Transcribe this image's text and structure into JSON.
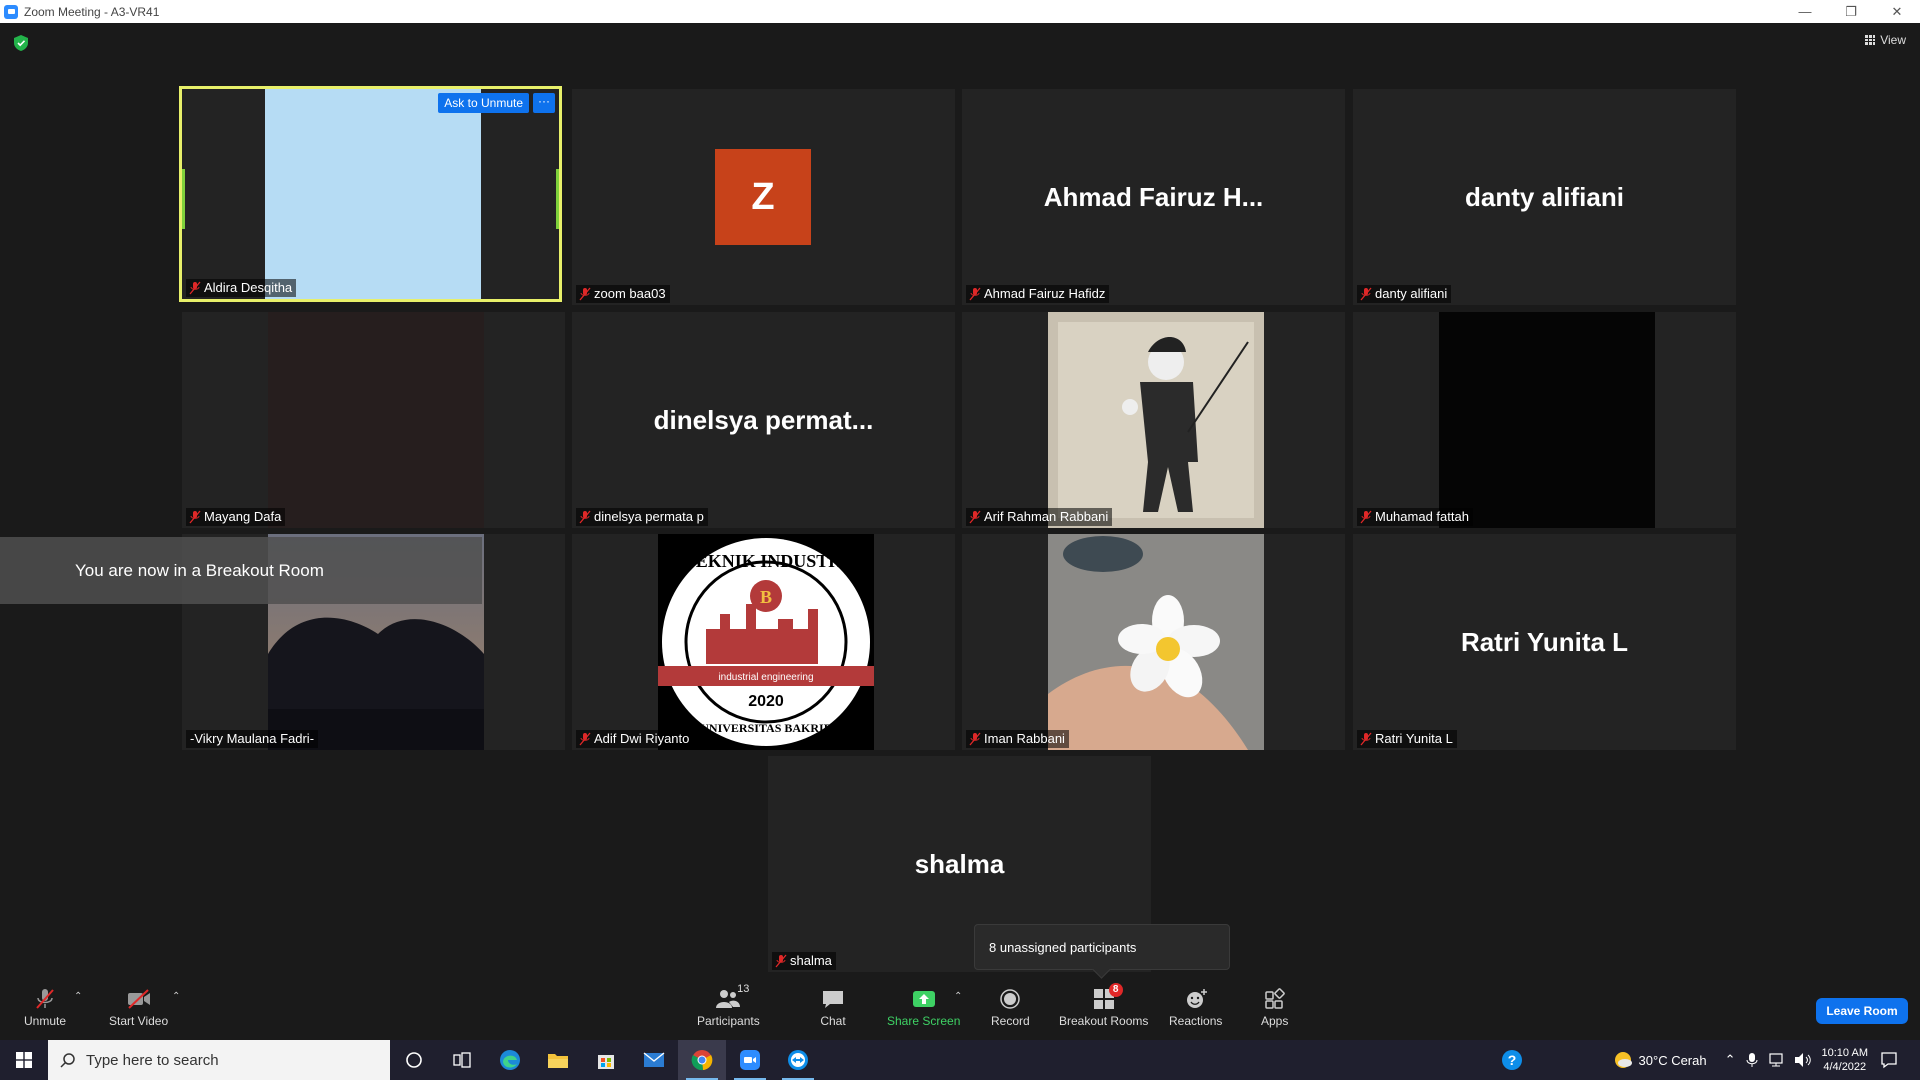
{
  "window": {
    "title": "Zoom Meeting - A3-VR41"
  },
  "header": {
    "view_label": "View"
  },
  "tiles": [
    {
      "name": "Aldira Desqitha",
      "ask_unmute": "Ask to Unmute",
      "more": "···"
    },
    {
      "name": "zoom baa03",
      "avatar_letter": "Z",
      "avatar_color": "#c7421a"
    },
    {
      "name": "Ahmad Fairuz Hafidz",
      "display_name": "Ahmad  Fairuz  H..."
    },
    {
      "name": "danty alifiani",
      "display_name": "danty alifiani"
    },
    {
      "name": "Mayang Dafa"
    },
    {
      "name": "dinelsya permata p",
      "display_name": "dinelsya  permat..."
    },
    {
      "name": "Arif Rahman Rabbani"
    },
    {
      "name": "Muhamad fattah"
    },
    {
      "name": "-Vikry Maulana Fadri-"
    },
    {
      "name": "Adif Dwi Riyanto",
      "logo_top": "TEKNIK INDUSTRI",
      "logo_mid": "industrial engineering",
      "logo_year": "2020",
      "logo_bottom": "UNIVERSITAS BAKRIE",
      "logo_letter": "B"
    },
    {
      "name": "Iman Rabbani"
    },
    {
      "name": "Ratri Yunita L",
      "display_name": "Ratri Yunita L"
    },
    {
      "name": "shalma",
      "display_name": "shalma"
    }
  ],
  "notifications": {
    "breakout_banner": "You are now in a Breakout Room",
    "unassigned": "8 unassigned participants"
  },
  "toolbar": {
    "unmute": "Unmute",
    "start_video": "Start Video",
    "participants": "Participants",
    "participants_count": "13",
    "chat": "Chat",
    "share_screen": "Share Screen",
    "record": "Record",
    "breakout_rooms": "Breakout Rooms",
    "breakout_count": "8",
    "reactions": "Reactions",
    "apps": "Apps",
    "leave": "Leave Room"
  },
  "taskbar": {
    "search_placeholder": "Type here to search",
    "weather": "30°C  Cerah",
    "time": "10:10 AM",
    "date": "4/4/2022"
  },
  "colors": {
    "accent": "#0e72ed",
    "active_border": "#e8f06a",
    "share_green": "#3ed164",
    "alert_red": "#e02828"
  }
}
